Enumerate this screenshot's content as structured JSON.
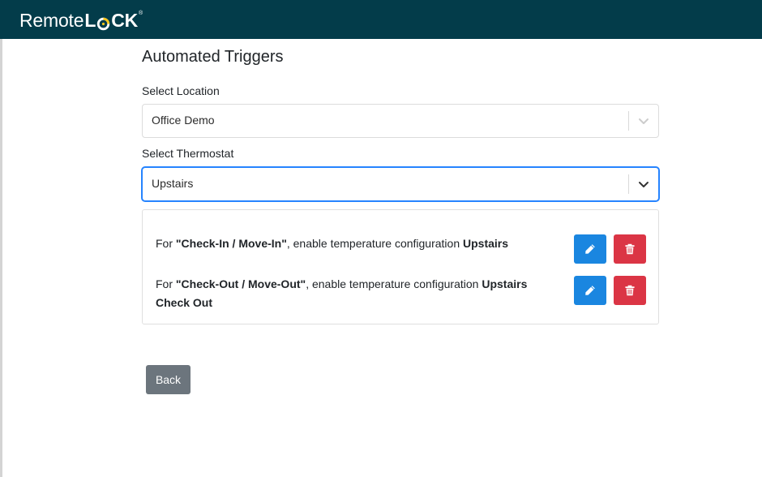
{
  "header": {
    "logo_remote": "Remote",
    "logo_l": "L",
    "logo_ck": "CK",
    "logo_tm": "®"
  },
  "page": {
    "title": "Automated Triggers"
  },
  "location": {
    "label": "Select Location",
    "value": "Office Demo"
  },
  "thermostat": {
    "label": "Select Thermostat",
    "value": "Upstairs"
  },
  "triggers": [
    {
      "prefix": "For ",
      "event": "\"Check-In / Move-In\"",
      "middle": ", enable temperature configuration ",
      "config": "Upstairs"
    },
    {
      "prefix": "For ",
      "event": "\"Check-Out / Move-Out\"",
      "middle": ", enable temperature configuration ",
      "config": "Upstairs Check Out"
    }
  ],
  "actions": {
    "back_label": "Back"
  },
  "colors": {
    "header_bg": "#033c4a",
    "brand_accent": "#f5c518",
    "edit_blue": "#1a86e0",
    "delete_red": "#db3545",
    "focus_blue": "#2684ff",
    "back_gray": "#6c757d"
  },
  "icons": {
    "edit": "pencil-icon",
    "delete": "trash-icon",
    "dropdown": "chevron-down-icon"
  }
}
